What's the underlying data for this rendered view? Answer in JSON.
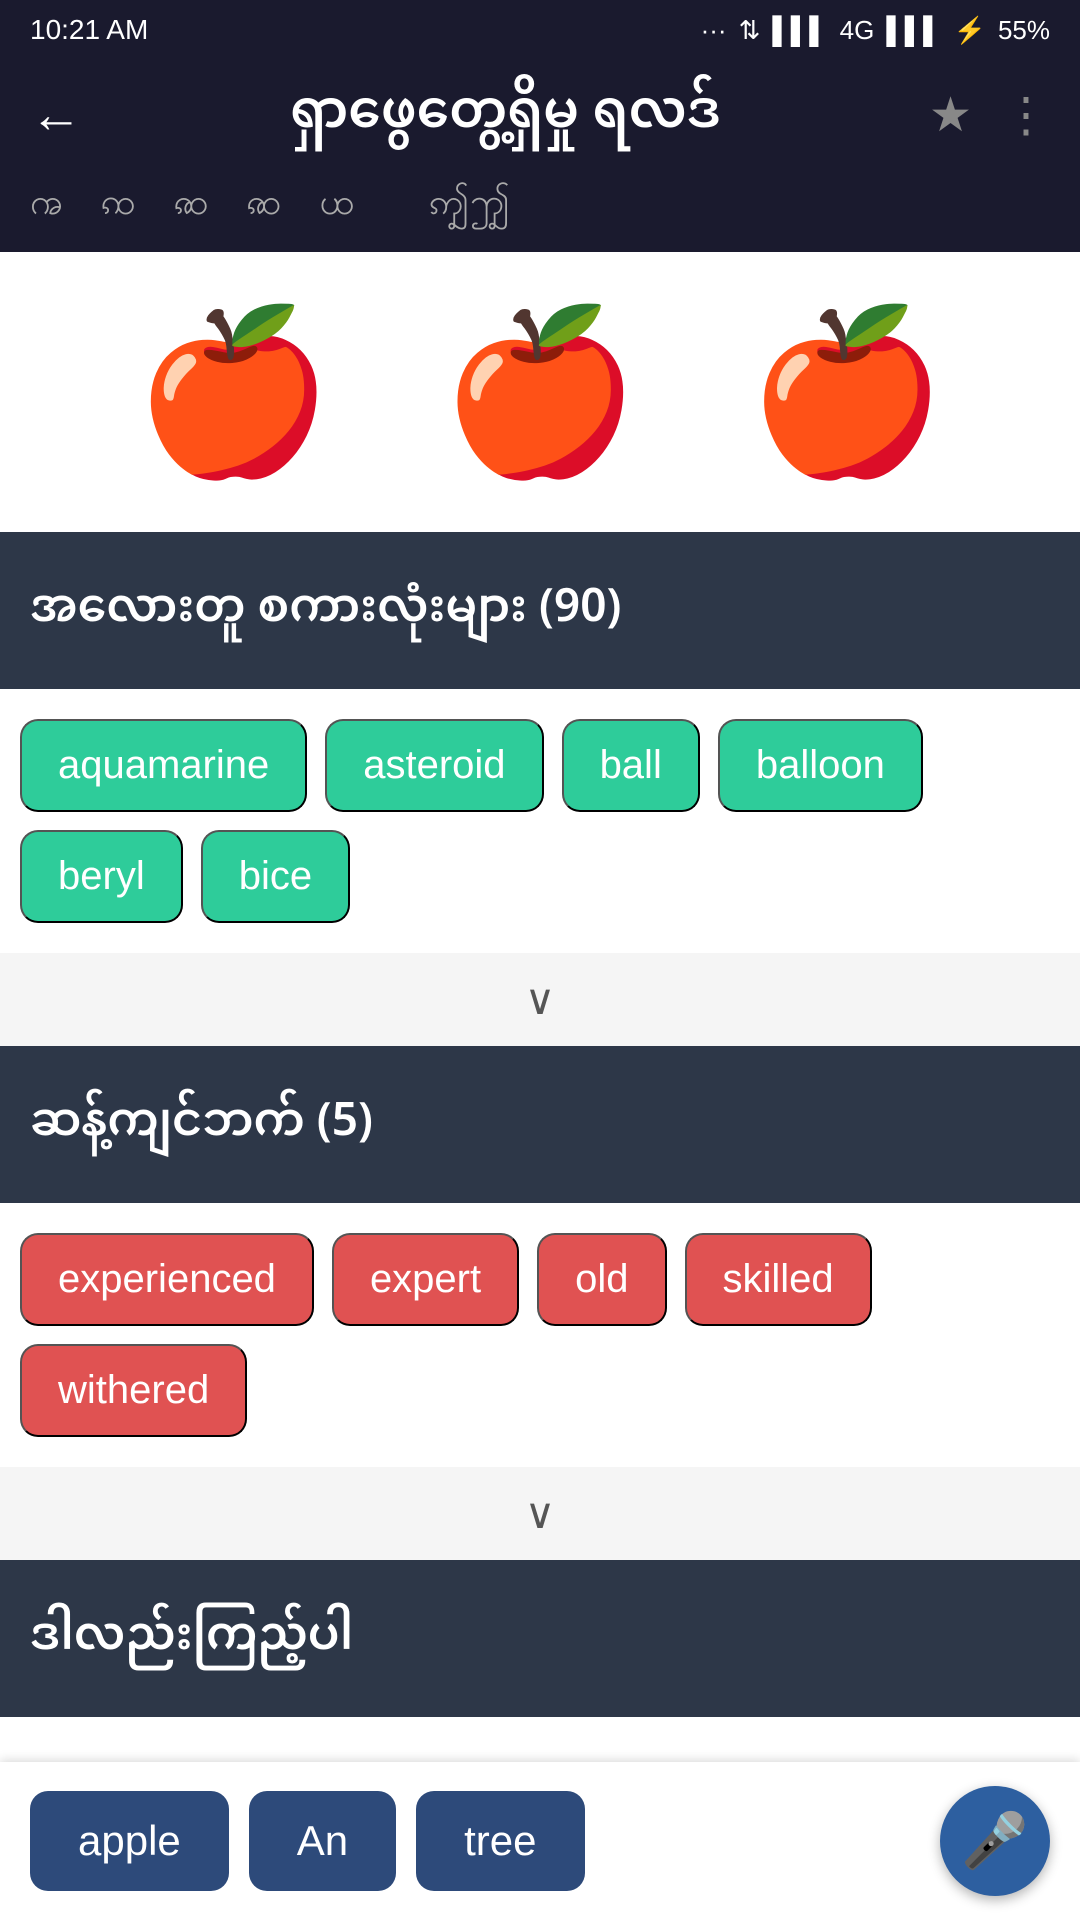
{
  "statusBar": {
    "time": "10:21 AM",
    "signal": "4G",
    "battery": "55%"
  },
  "navBar": {
    "title": "ရှာဖွေတွေ့ရှိမှု ရလဒ်",
    "backIcon": "←",
    "bookmarkIcon": "★",
    "menuIcon": "⋮"
  },
  "subtitleBar": {
    "text": "ꩠ  ꩡ  ꩣ  ꩣ  ꩤ        ꩵꩶ"
  },
  "appleSection": {
    "appleSymbol": ""
  },
  "colorSection": {
    "header": "အလေားတူ စကားလုံးများ (90)",
    "tags": [
      "aquamarine",
      "asteroid",
      "ball",
      "balloon",
      "beryl",
      "bice"
    ],
    "tagColor": "green",
    "expandIcon": "∨"
  },
  "synonymSection": {
    "header": "ဆန့်ကျင်ဘက် (5)",
    "tags": [
      "experienced",
      "expert",
      "old",
      "skilled",
      "withered"
    ],
    "tagColor": "red",
    "expandIcon": "∨"
  },
  "exampleSection": {
    "header": "ဒါလည်းကြည့်ပါ"
  },
  "bottomBar": {
    "words": [
      "apple",
      "An",
      "tree"
    ],
    "micIcon": "🎤"
  }
}
